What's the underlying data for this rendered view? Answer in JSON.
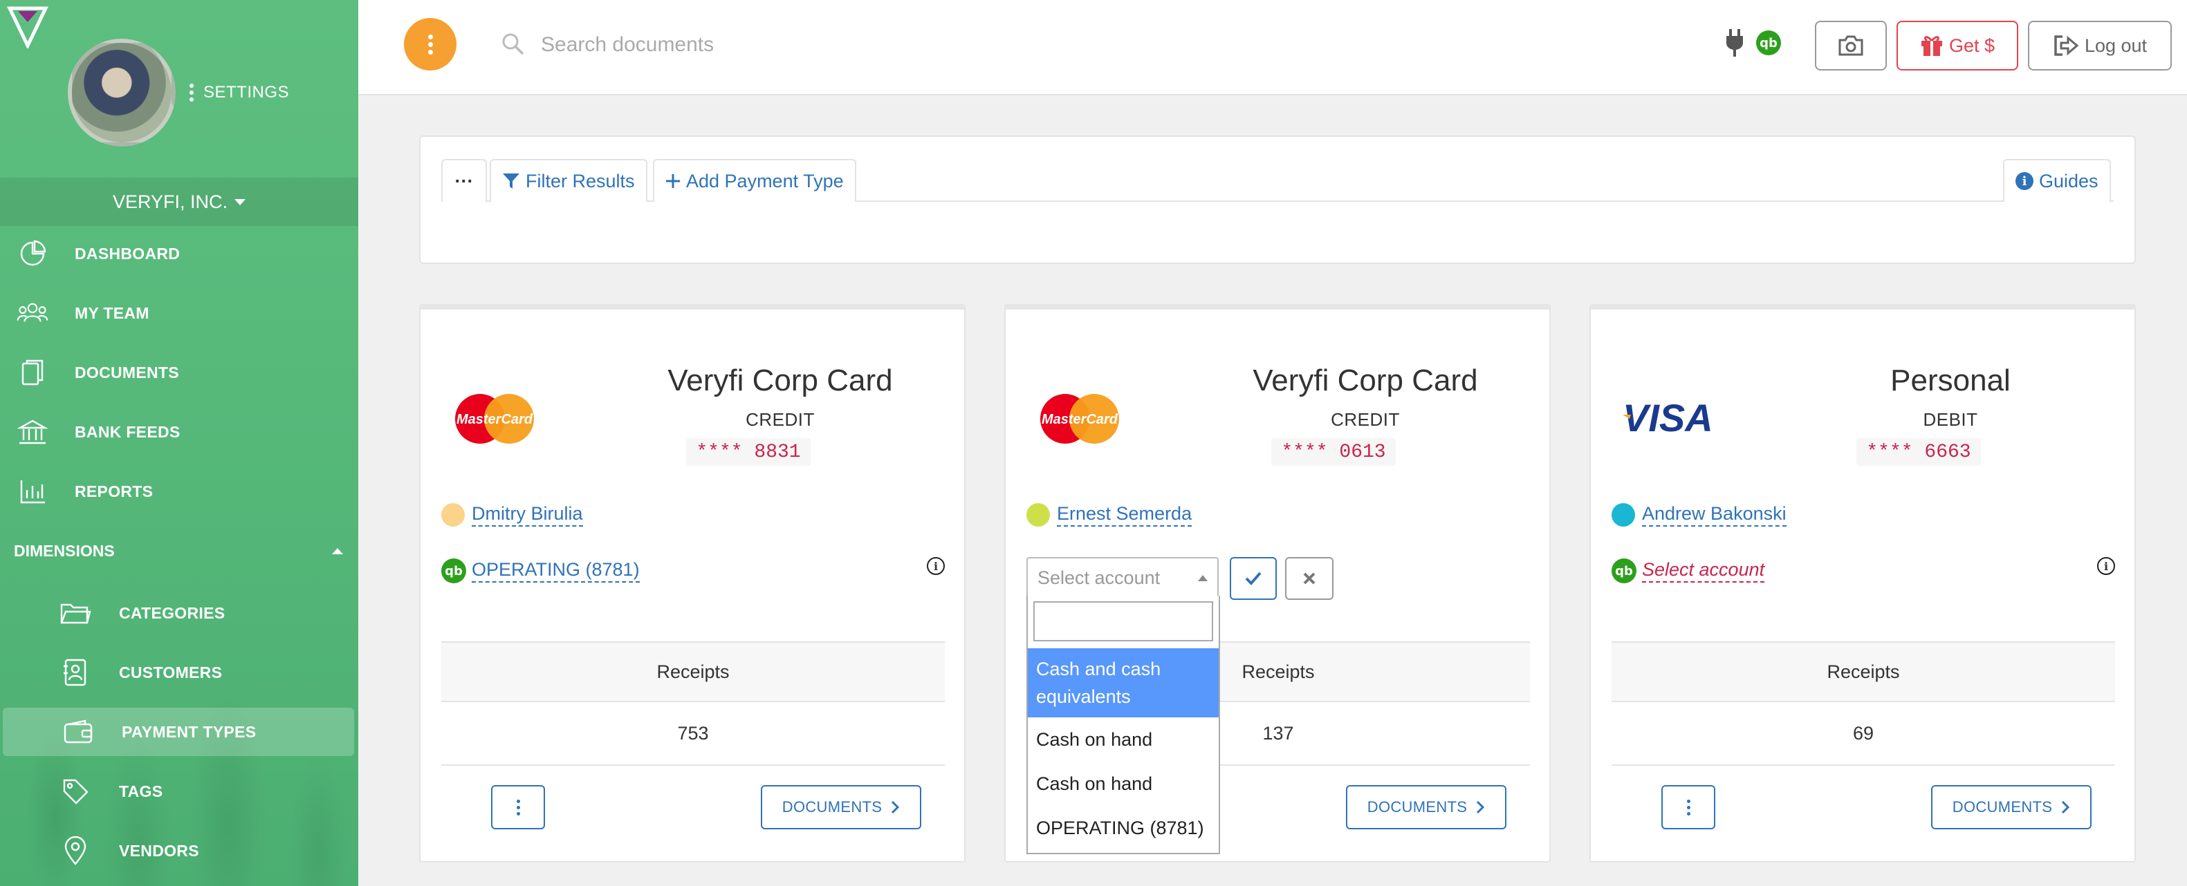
{
  "sidebar": {
    "settings_label": "SETTINGS",
    "org_name": "VERYFI, INC.",
    "items": [
      {
        "label": "DASHBOARD",
        "icon": "dashboard-icon"
      },
      {
        "label": "MY TEAM",
        "icon": "team-icon"
      },
      {
        "label": "DOCUMENTS",
        "icon": "documents-icon"
      },
      {
        "label": "BANK FEEDS",
        "icon": "bank-icon"
      },
      {
        "label": "REPORTS",
        "icon": "reports-icon"
      }
    ],
    "dimensions_label": "DIMENSIONS",
    "sub_items": [
      {
        "label": "CATEGORIES",
        "icon": "folder-icon"
      },
      {
        "label": "CUSTOMERS",
        "icon": "customer-icon"
      },
      {
        "label": "PAYMENT TYPES",
        "icon": "wallet-icon",
        "active": true
      },
      {
        "label": "TAGS",
        "icon": "tag-icon"
      },
      {
        "label": "VENDORS",
        "icon": "location-icon"
      }
    ]
  },
  "topbar": {
    "search_placeholder": "Search documents",
    "get_label": "Get $",
    "logout_label": "Log out",
    "accent_color": "#f5a030"
  },
  "toolbar": {
    "more_label": "···",
    "filter_label": "Filter Results",
    "add_label": "Add Payment Type",
    "guides_label": "Guides"
  },
  "cards": [
    {
      "brand": "MasterCard",
      "name": "Veryfi Corp Card",
      "kind": "CREDIT",
      "number": "**** 8831",
      "owner": "Dmitry Birulia",
      "owner_color": "#fcd38a",
      "account": "OPERATING (8781)",
      "stat_label": "Receipts",
      "stat_value": "753",
      "docs_label": "DOCUMENTS"
    },
    {
      "brand": "MasterCard",
      "name": "Veryfi Corp Card",
      "kind": "CREDIT",
      "number": "**** 0613",
      "owner": "Ernest Semerda",
      "owner_color": "#cde04a",
      "account_select_placeholder": "Select account",
      "stat_label": "Receipts",
      "stat_value": "137",
      "docs_label": "DOCUMENTS"
    },
    {
      "brand": "VISA",
      "name": "Personal",
      "kind": "DEBIT",
      "number": "**** 6663",
      "owner": "Andrew Bakonski",
      "owner_color": "#1ab7d4",
      "account": "Select account",
      "stat_label": "Receipts",
      "stat_value": "69",
      "docs_label": "DOCUMENTS"
    }
  ],
  "account_dropdown": {
    "search_value": "",
    "options": [
      "Cash and cash equivalents",
      "Cash on hand",
      "Cash on hand",
      "OPERATING (8781)"
    ],
    "selected": "Cash and cash equivalents"
  }
}
